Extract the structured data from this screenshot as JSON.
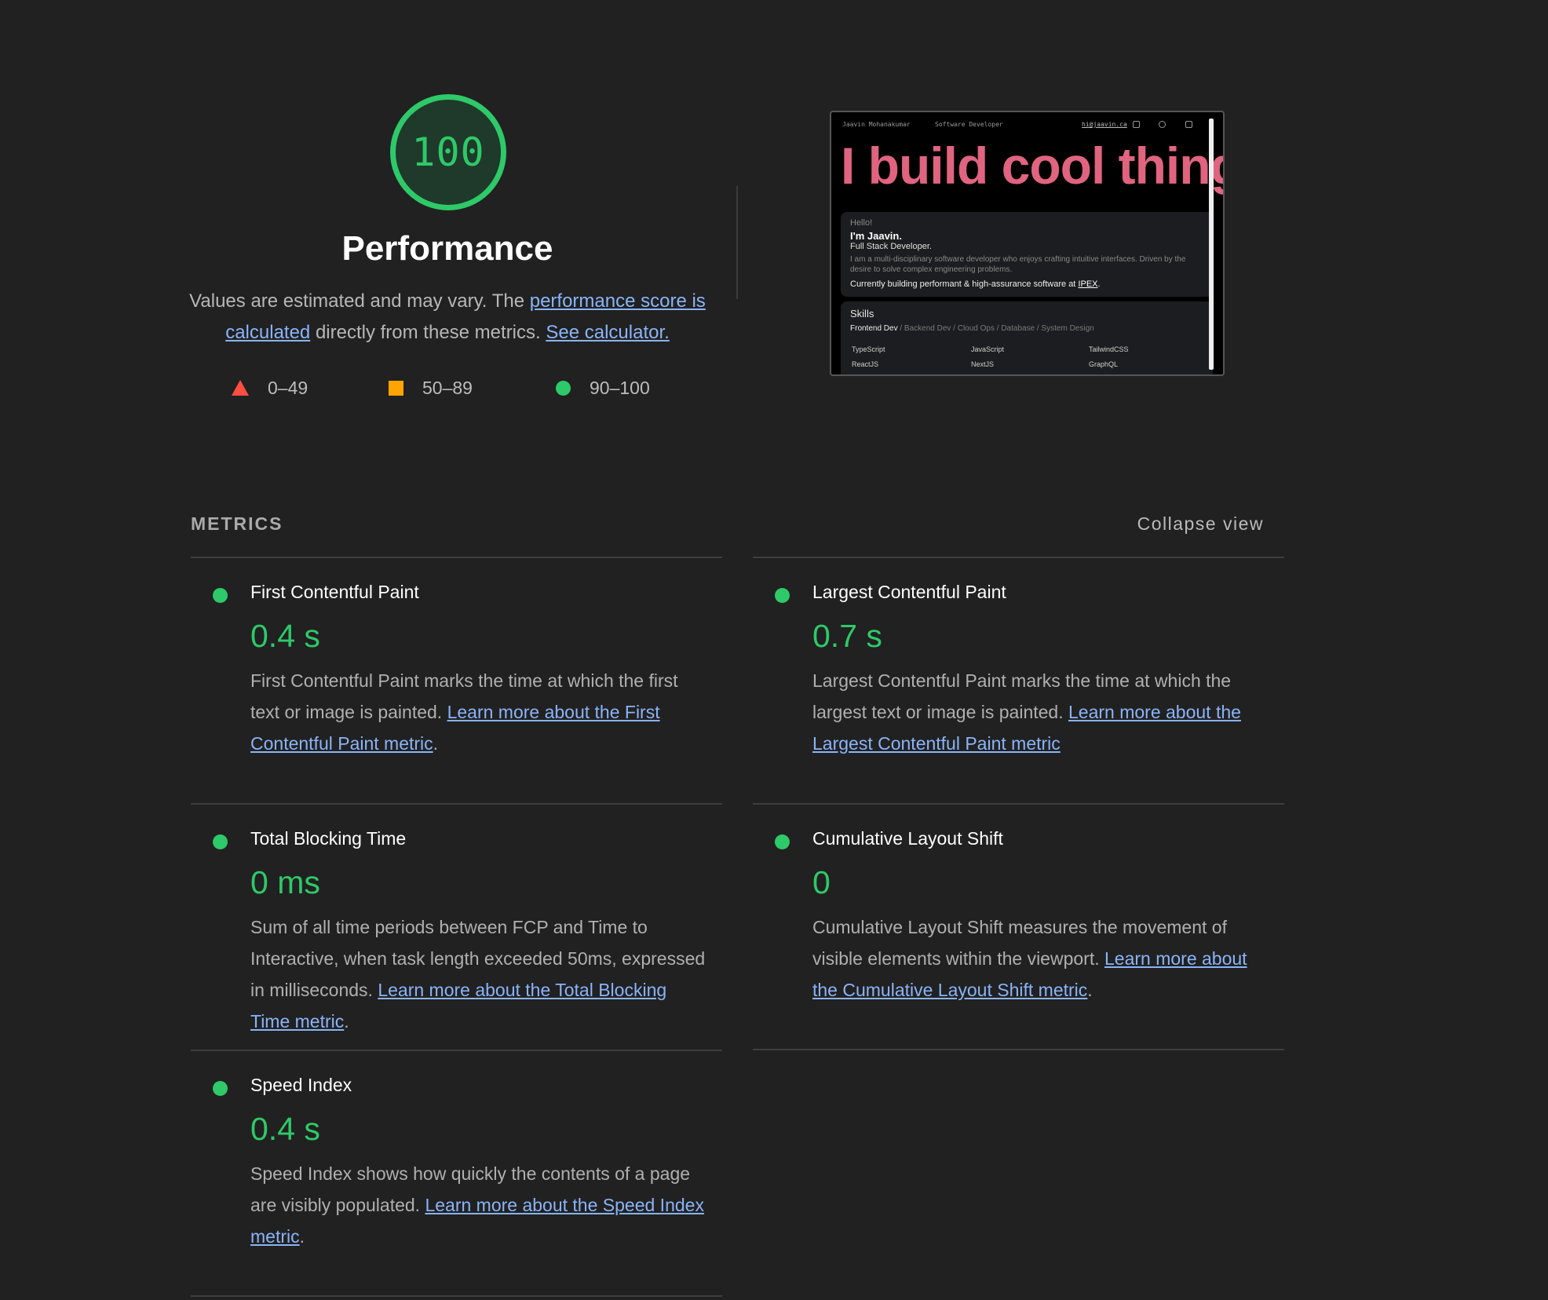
{
  "score": {
    "value": "100",
    "title": "Performance",
    "desc_prefix": "Values are estimated and may vary. The ",
    "desc_link1": "performance score is calculated",
    "desc_mid": " directly from these metrics. ",
    "desc_link2": "See calculator.",
    "legend": [
      {
        "range": "0–49",
        "shape": "triangle",
        "color": "#ff4e42"
      },
      {
        "range": "50–89",
        "shape": "square",
        "color": "#ffa400"
      },
      {
        "range": "90–100",
        "shape": "circle",
        "color": "#2ec969"
      }
    ],
    "color": "#2ec969"
  },
  "thumbnail": {
    "nav_name": "Jaavin Mohanakumar",
    "nav_role": "Software Developer",
    "nav_email": "hi@jaavin.ca",
    "hero": "I build cool things",
    "hello": "Hello!",
    "name": "I'm Jaavin.",
    "role": "Full Stack Developer.",
    "bio": "I am a multi-disciplinary software developer who enjoys crafting intuitive interfaces. Driven by the desire to solve complex engineering problems.",
    "current_prefix": "Currently building performant & high-assurance software at ",
    "current_company": "IPEX",
    "current_suffix": ".",
    "skills_title": "Skills",
    "skills_active_tab": "Frontend Dev",
    "skills_other_tabs": " / Backend Dev / Cloud Ops / Database / System Design",
    "skills": [
      "TypeScript",
      "JavaScript",
      "TailwindCSS",
      "ReactJS",
      "NextJS",
      "GraphQL"
    ]
  },
  "metrics": {
    "heading": "METRICS",
    "collapse_label": "Collapse view",
    "fcp": {
      "title": "First Contentful Paint",
      "value": "0.4 s",
      "desc": "First Contentful Paint marks the time at which the first text or image is painted. ",
      "link": "Learn more about the First Contentful Paint metric",
      "suffix": "."
    },
    "lcp": {
      "title": "Largest Contentful Paint",
      "value": "0.7 s",
      "desc": "Largest Contentful Paint marks the time at which the largest text or image is painted. ",
      "link": "Learn more about the Largest Contentful Paint metric",
      "suffix": ""
    },
    "tbt": {
      "title": "Total Blocking Time",
      "value": "0 ms",
      "desc": "Sum of all time periods between FCP and Time to Interactive, when task length exceeded 50ms, expressed in milliseconds. ",
      "link": "Learn more about the Total Blocking Time metric",
      "suffix": "."
    },
    "cls": {
      "title": "Cumulative Layout Shift",
      "value": "0",
      "desc": "Cumulative Layout Shift measures the movement of visible elements within the viewport. ",
      "link": "Learn more about the Cumulative Layout Shift metric",
      "suffix": "."
    },
    "si": {
      "title": "Speed Index",
      "value": "0.4 s",
      "desc": "Speed Index shows how quickly the contents of a page are visibly populated. ",
      "link": "Learn more about the Speed Index metric",
      "suffix": "."
    }
  }
}
